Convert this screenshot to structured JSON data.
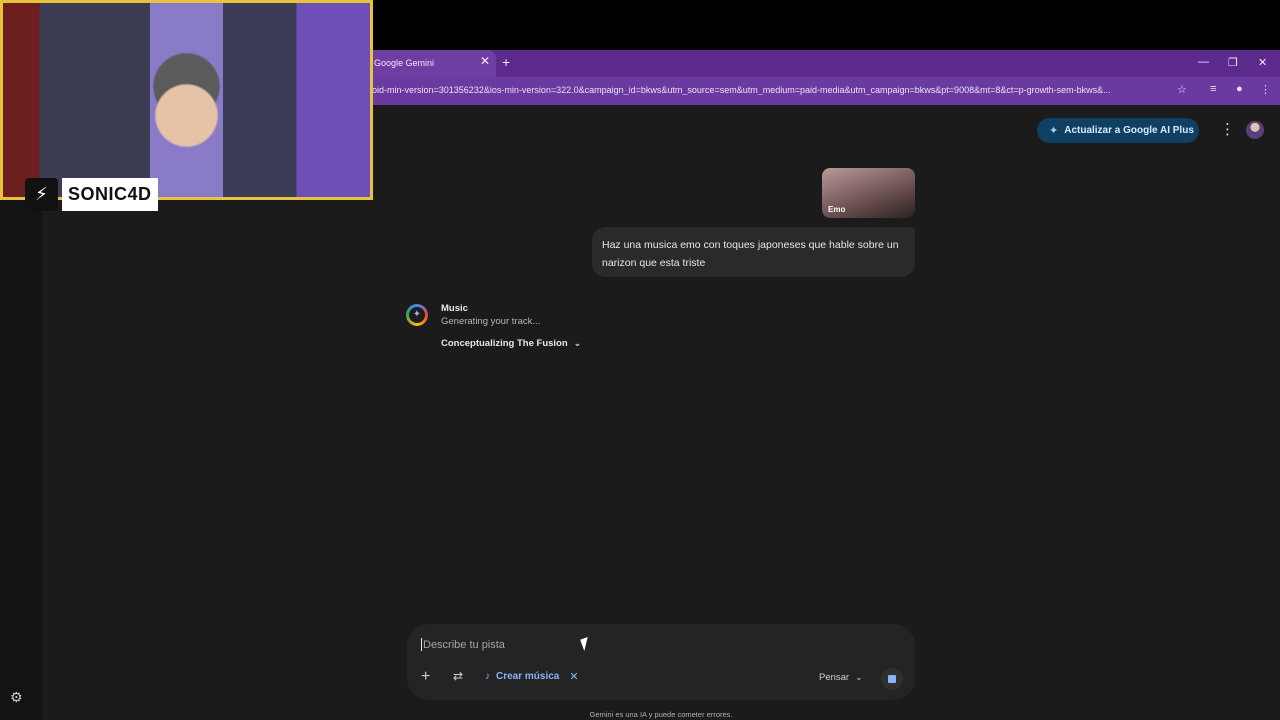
{
  "browser": {
    "tab_title": "Google Gemini",
    "url": "oid-min-version=301356232&ios-min-version=322.0&campaign_id=bkws&utm_source=sem&utm_medium=paid-media&utm_campaign=bkws&pt=9008&mt=8&ct=p-growth-sem-bkws&...",
    "icons": [
      "close-icon",
      "plus-icon",
      "minimize-icon",
      "restore-icon",
      "star-icon",
      "media-icon",
      "extension-icon",
      "more-icon"
    ]
  },
  "header": {
    "upgrade_label": "Actualizar a Google AI Plus"
  },
  "chat": {
    "image_label": "Emo",
    "user_message": "Haz una musica emo con toques japoneses que hable sobre un narizon que esta triste",
    "response": {
      "title": "Music",
      "status": "Generating your track...",
      "step": "Conceptualizing The Fusion"
    }
  },
  "composer": {
    "placeholder": "Describe tu pista",
    "chip_label": "Crear música",
    "mode_label": "Pensar"
  },
  "disclaimer": "Gemini es una IA y puede cometer errores.",
  "overlay": {
    "streamer_name": "SONIC4D"
  },
  "colors": {
    "tabbar": "#5b2a8c",
    "urlbar": "#6a3aa0",
    "background": "#1b1b1b",
    "accent": "#8ab4f8",
    "upgrade_bg": "#0f3f63",
    "webcam_frame": "#e8c43e"
  }
}
